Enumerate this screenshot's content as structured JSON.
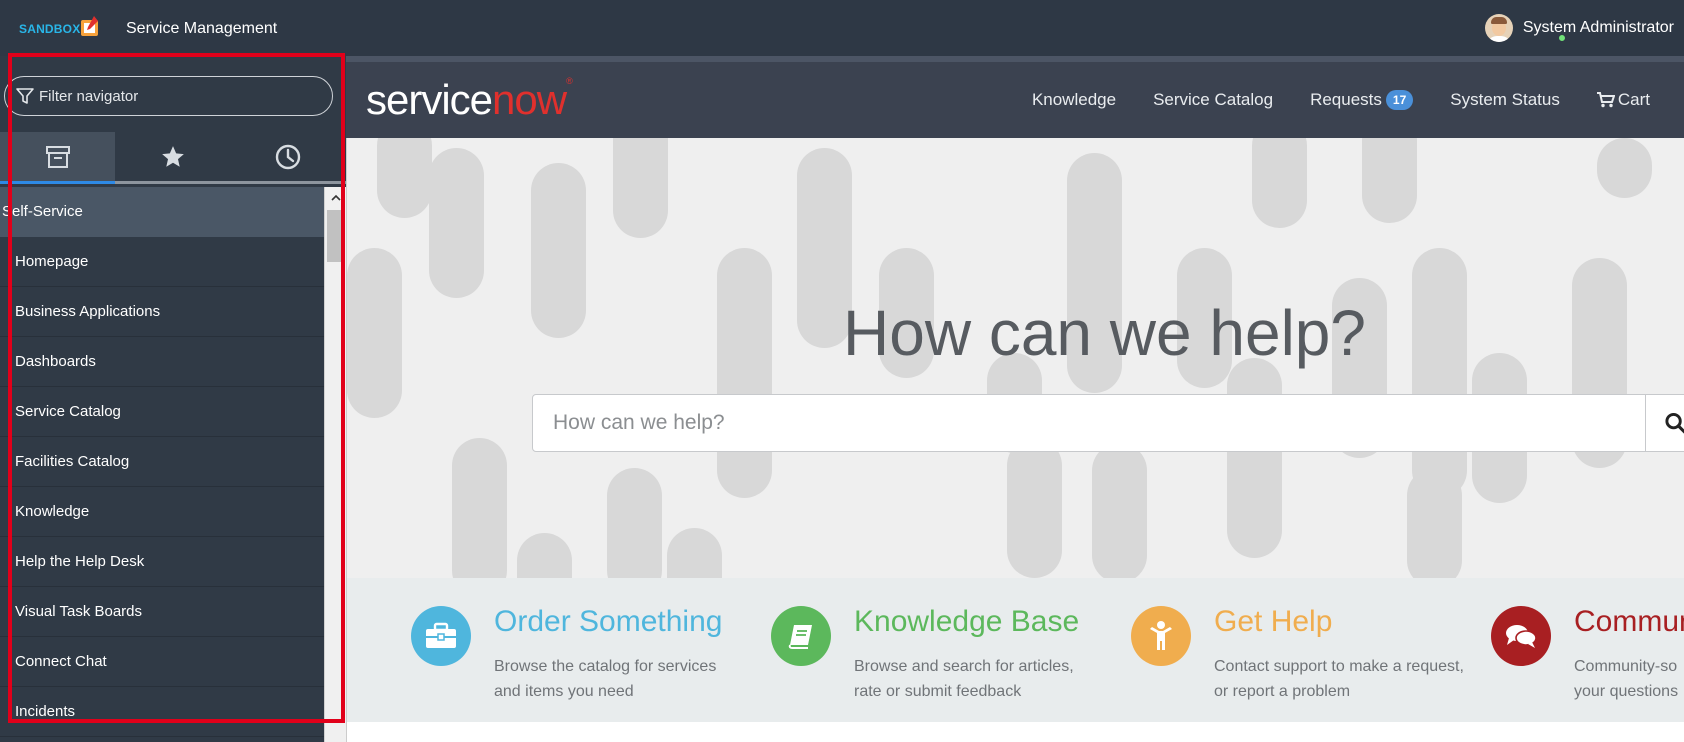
{
  "topbar": {
    "sandbox_label": "SANDBOX",
    "app_title": "Service Management",
    "user_name": "System Administrator"
  },
  "navigator": {
    "filter_placeholder": "Filter navigator",
    "tabs": [
      {
        "name": "all-apps",
        "icon": "archive-icon",
        "active": true
      },
      {
        "name": "favorites",
        "icon": "star-icon",
        "active": false
      },
      {
        "name": "history",
        "icon": "clock-icon",
        "active": false
      }
    ],
    "section": "Self-Service",
    "items": [
      "Homepage",
      "Business Applications",
      "Dashboards",
      "Service Catalog",
      "Facilities Catalog",
      "Knowledge",
      "Help the Help Desk",
      "Visual Task Boards",
      "Connect Chat",
      "Incidents"
    ]
  },
  "portal": {
    "logo_part1": "service",
    "logo_part2": "now",
    "menu": {
      "knowledge": "Knowledge",
      "service_catalog": "Service Catalog",
      "requests": "Requests",
      "requests_count": "17",
      "system_status": "System Status",
      "cart": "Cart"
    },
    "hero_title": "How can we help?",
    "search_placeholder": "How can we help?",
    "features": [
      {
        "title": "Order Something",
        "desc": "Browse the catalog for services and items you need",
        "color": "#4fb6dd",
        "icon": "briefcase-icon"
      },
      {
        "title": "Knowledge Base",
        "desc": "Browse and search for articles, rate or submit feedback",
        "color": "#5cb85c",
        "icon": "book-icon"
      },
      {
        "title": "Get Help",
        "desc": "Contact support to make a request, or report a problem",
        "color": "#f0ad4e",
        "icon": "person-icon"
      },
      {
        "title": "Commun",
        "desc": "Community-so your questions",
        "color": "#a81f22",
        "icon": "chat-icon"
      }
    ]
  }
}
